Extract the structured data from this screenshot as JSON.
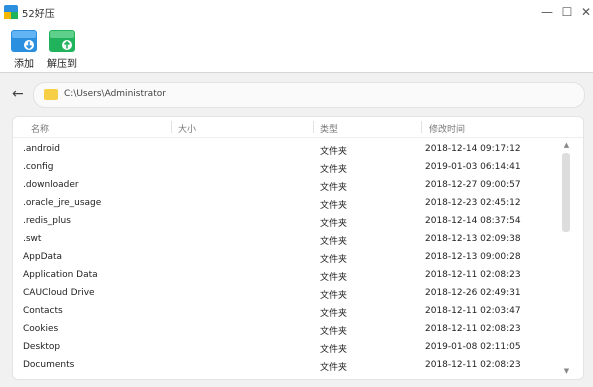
{
  "window": {
    "title": "52好压",
    "minimize_glyph": "—",
    "maximize_glyph": "☐",
    "close_glyph": "✕"
  },
  "toolbar": {
    "add_label": "添加",
    "extract_label": "解压到"
  },
  "address": {
    "back_glyph": "←",
    "path": "C:\\Users\\Administrator"
  },
  "columns": {
    "name": "名称",
    "size": "大小",
    "type": "类型",
    "modified": "修改时间"
  },
  "files": [
    {
      "name": ".android",
      "size": "",
      "type": "文件夹",
      "modified": "2018-12-14 09:17:12"
    },
    {
      "name": ".config",
      "size": "",
      "type": "文件夹",
      "modified": "2019-01-03 06:14:41"
    },
    {
      "name": ".downloader",
      "size": "",
      "type": "文件夹",
      "modified": "2018-12-27 09:00:57"
    },
    {
      "name": ".oracle_jre_usage",
      "size": "",
      "type": "文件夹",
      "modified": "2018-12-23 02:45:12"
    },
    {
      "name": ".redis_plus",
      "size": "",
      "type": "文件夹",
      "modified": "2018-12-14 08:37:54"
    },
    {
      "name": ".swt",
      "size": "",
      "type": "文件夹",
      "modified": "2018-12-13 02:09:38"
    },
    {
      "name": "AppData",
      "size": "",
      "type": "文件夹",
      "modified": "2018-12-13 09:00:28"
    },
    {
      "name": "Application Data",
      "size": "",
      "type": "文件夹",
      "modified": "2018-12-11 02:08:23"
    },
    {
      "name": "CAUCloud Drive",
      "size": "",
      "type": "文件夹",
      "modified": "2018-12-26 02:49:31"
    },
    {
      "name": "Contacts",
      "size": "",
      "type": "文件夹",
      "modified": "2018-12-11 02:03:47"
    },
    {
      "name": "Cookies",
      "size": "",
      "type": "文件夹",
      "modified": "2018-12-11 02:08:23"
    },
    {
      "name": "Desktop",
      "size": "",
      "type": "文件夹",
      "modified": "2019-01-08 02:11:05"
    },
    {
      "name": "Documents",
      "size": "",
      "type": "文件夹",
      "modified": "2018-12-11 02:08:23"
    }
  ],
  "colors": {
    "accent_blue": "#2b8fe0",
    "accent_green": "#21b35b",
    "folder_yellow": "#f7cf47"
  }
}
